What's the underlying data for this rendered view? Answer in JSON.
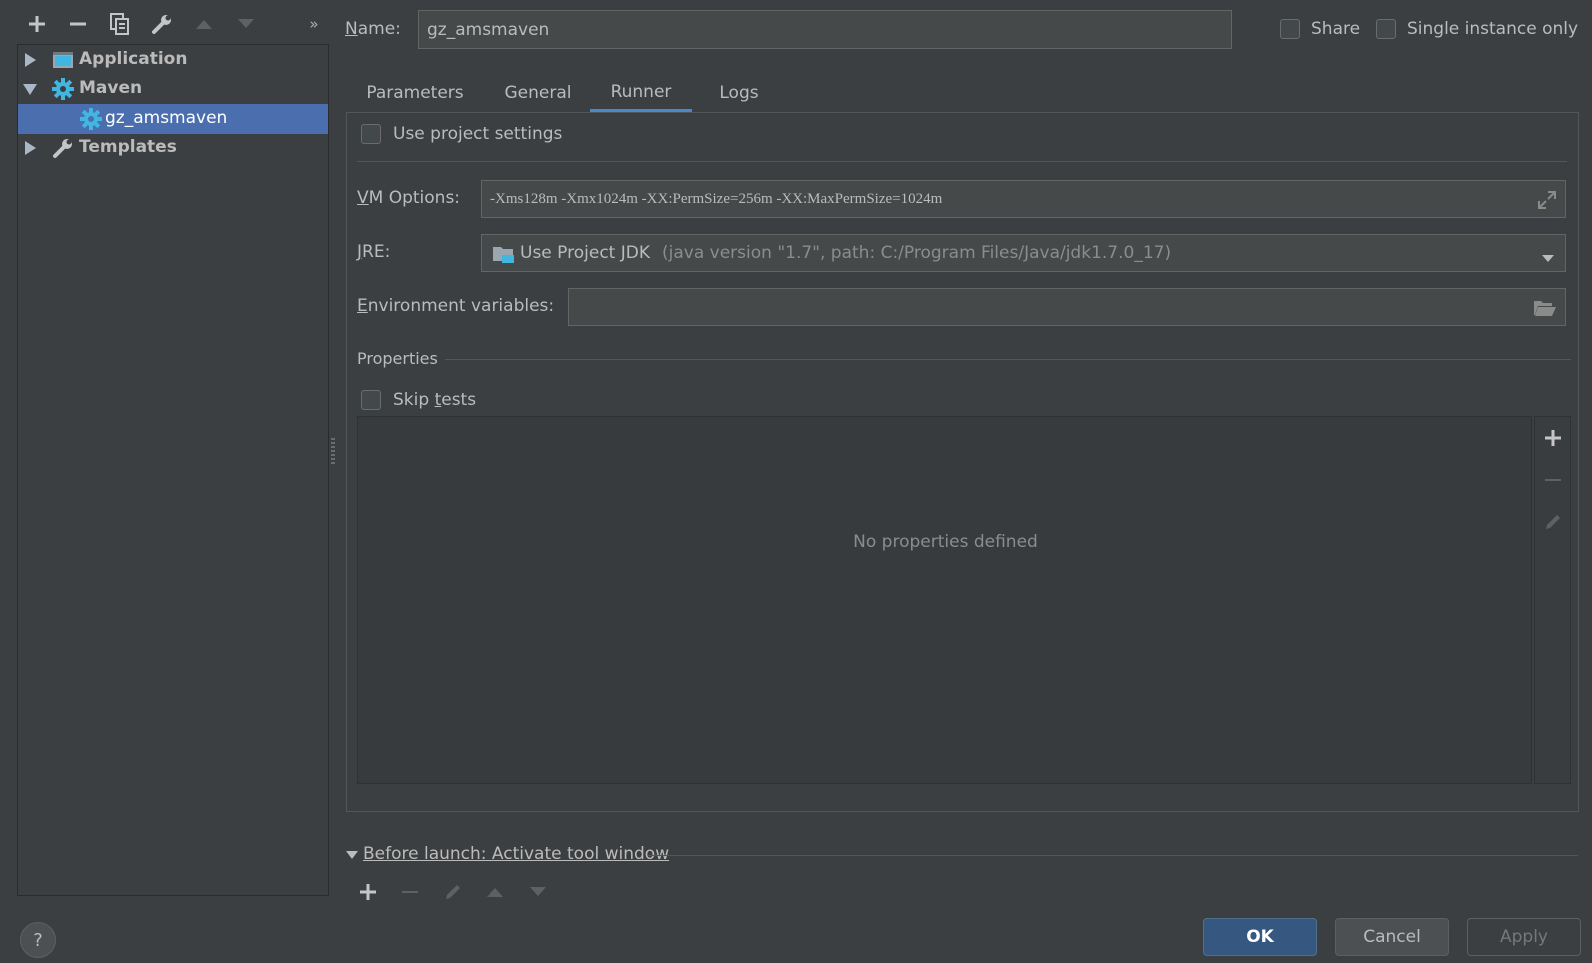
{
  "toolbar": {
    "icons": [
      "add-icon",
      "remove-icon",
      "copy-icon",
      "wrench-icon",
      "move-up-icon",
      "move-down-icon",
      "more-icon"
    ]
  },
  "tree": {
    "items": [
      {
        "label": "Application",
        "icon": "application-icon",
        "expanded": false
      },
      {
        "label": "Maven",
        "icon": "gear-icon",
        "expanded": true
      },
      {
        "label": "gz_amsmaven",
        "icon": "gear-icon",
        "selected": true
      },
      {
        "label": "Templates",
        "icon": "wrench-icon",
        "expanded": false
      }
    ]
  },
  "header": {
    "name_label": "Name:",
    "name_value": "gz_amsmaven",
    "share_label": "Share",
    "single_instance_label": "Single instance only"
  },
  "tabs": [
    {
      "label": "Parameters"
    },
    {
      "label": "General"
    },
    {
      "label": "Runner",
      "active": true
    },
    {
      "label": "Logs"
    }
  ],
  "runner": {
    "use_project_settings": "Use project settings",
    "vm_options_label": "VM Options:",
    "vm_options_value": "-Xms128m -Xmx1024m -XX:PermSize=256m -XX:MaxPermSize=1024m",
    "jre_label": "JRE:",
    "jre_value": "Use Project JDK",
    "jre_detail": "(java version \"1.7\", path: C:/Program Files/Java/jdk1.7.0_17)",
    "env_label": "Environment variables:",
    "env_value": "",
    "properties_title": "Properties",
    "skip_tests": "Skip tests",
    "empty_text": "No properties defined"
  },
  "before_launch": {
    "label": "Before launch: Activate tool window"
  },
  "buttons": {
    "ok": "OK",
    "cancel": "Cancel",
    "apply": "Apply"
  },
  "colors": {
    "background": "#3c3f41",
    "selection": "#4b6eaf",
    "accent": "#4a88c7",
    "input": "#45494a",
    "ok_button": "#365880"
  }
}
